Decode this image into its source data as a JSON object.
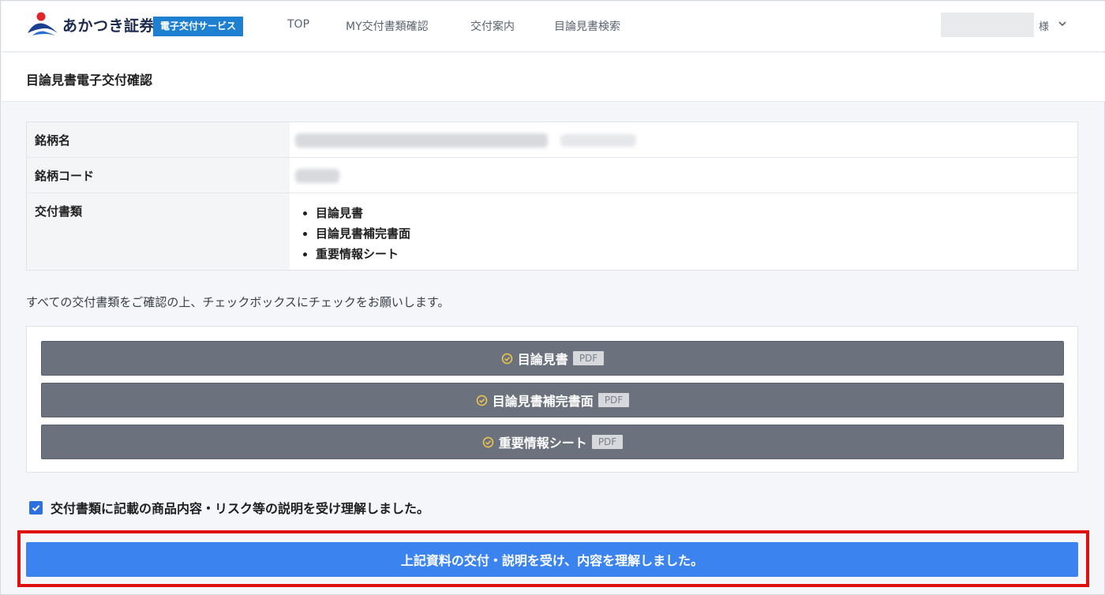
{
  "header": {
    "brand": "あかつき証券",
    "service_badge": "電子交付サービス",
    "nav": [
      "TOP",
      "MY交付書類確認",
      "交付案内",
      "目論見書検索"
    ],
    "user_suffix": "様"
  },
  "page_title": "目論見書電子交付確認",
  "info": {
    "rows": [
      {
        "label": "銘柄名"
      },
      {
        "label": "銘柄コード"
      },
      {
        "label": "交付書類"
      }
    ],
    "documents": [
      "目論見書",
      "目論見書補完書面",
      "重要情報シート"
    ]
  },
  "instruction": "すべての交付書類をご確認の上、チェックボックスにチェックをお願いします。",
  "doc_buttons": [
    {
      "label": "目論見書",
      "badge": "PDF"
    },
    {
      "label": "目論見書補完書面",
      "badge": "PDF"
    },
    {
      "label": "重要情報シート",
      "badge": "PDF"
    }
  ],
  "agreement": {
    "label": "交付書類に記載の商品内容・リスク等の説明を受け理解しました。",
    "checked": true
  },
  "submit": {
    "label": "上記資料の交付・説明を受け、内容を理解しました。"
  },
  "colors": {
    "brand_blue": "#1f7fd1",
    "button_gray": "#6b717d",
    "check_yellow": "#f2c94c",
    "primary": "#3b84f0",
    "highlight_red": "#e20f0f"
  }
}
